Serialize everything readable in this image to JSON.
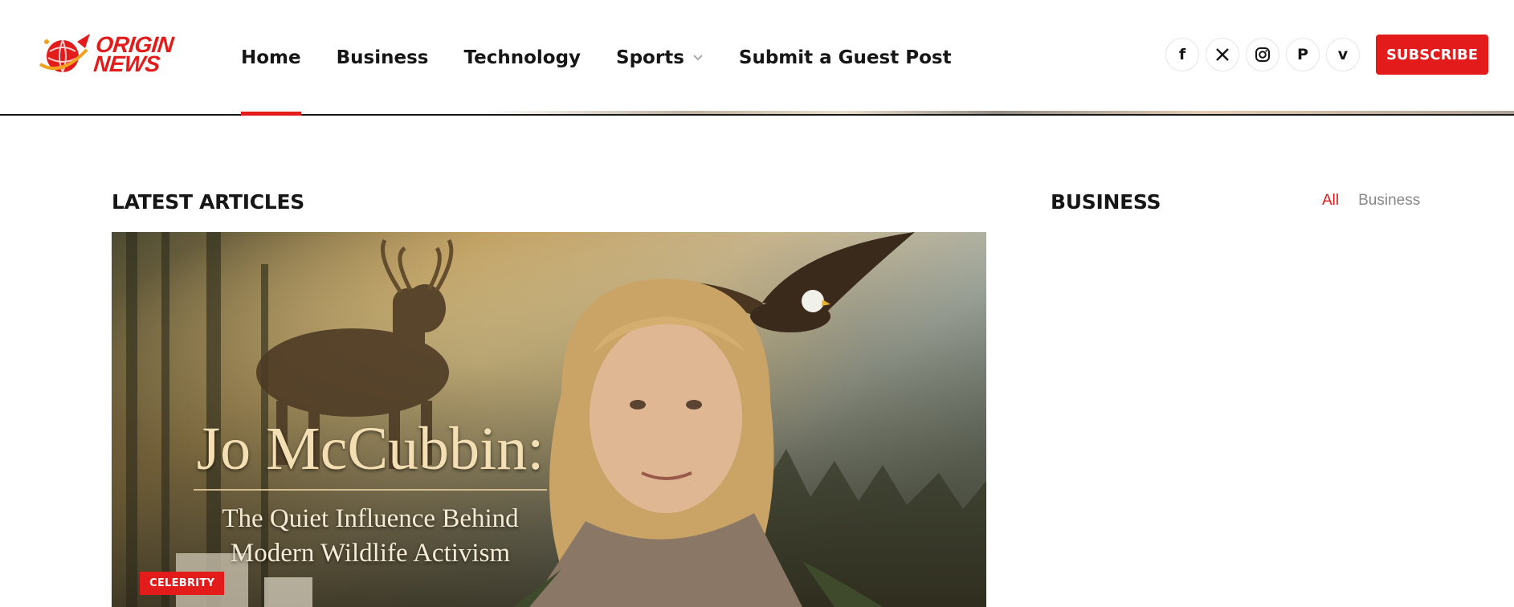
{
  "header": {
    "logo": {
      "line1": "ORIGIN",
      "line2": "NEWS"
    },
    "nav": [
      {
        "label": "Home",
        "active": true
      },
      {
        "label": "Business"
      },
      {
        "label": "Technology"
      },
      {
        "label": "Sports",
        "has_dropdown": true
      },
      {
        "label": "Submit a Guest Post"
      }
    ],
    "socials": [
      {
        "icon": "facebook-icon",
        "glyph": "f"
      },
      {
        "icon": "x-icon",
        "glyph": "𝕏"
      },
      {
        "icon": "instagram-icon",
        "glyph": ""
      },
      {
        "icon": "pinterest-icon",
        "glyph": "P"
      },
      {
        "icon": "vimeo-icon",
        "glyph": "v"
      }
    ],
    "subscribe_label": "SUBSCRIBE"
  },
  "main": {
    "latest_title": "LATEST ARTICLES",
    "hero": {
      "headline": "Jo McCubbin:",
      "subline1": "The Quiet Influence Behind",
      "subline2": "Modern Wildlife Activism",
      "category": "CELEBRITY"
    }
  },
  "sidebar": {
    "title": "BUSINESS",
    "filters": [
      {
        "label": "All",
        "active": true
      },
      {
        "label": "Business"
      }
    ]
  },
  "colors": {
    "accent": "#e41b1b",
    "text": "#161616",
    "muted": "#888888"
  }
}
